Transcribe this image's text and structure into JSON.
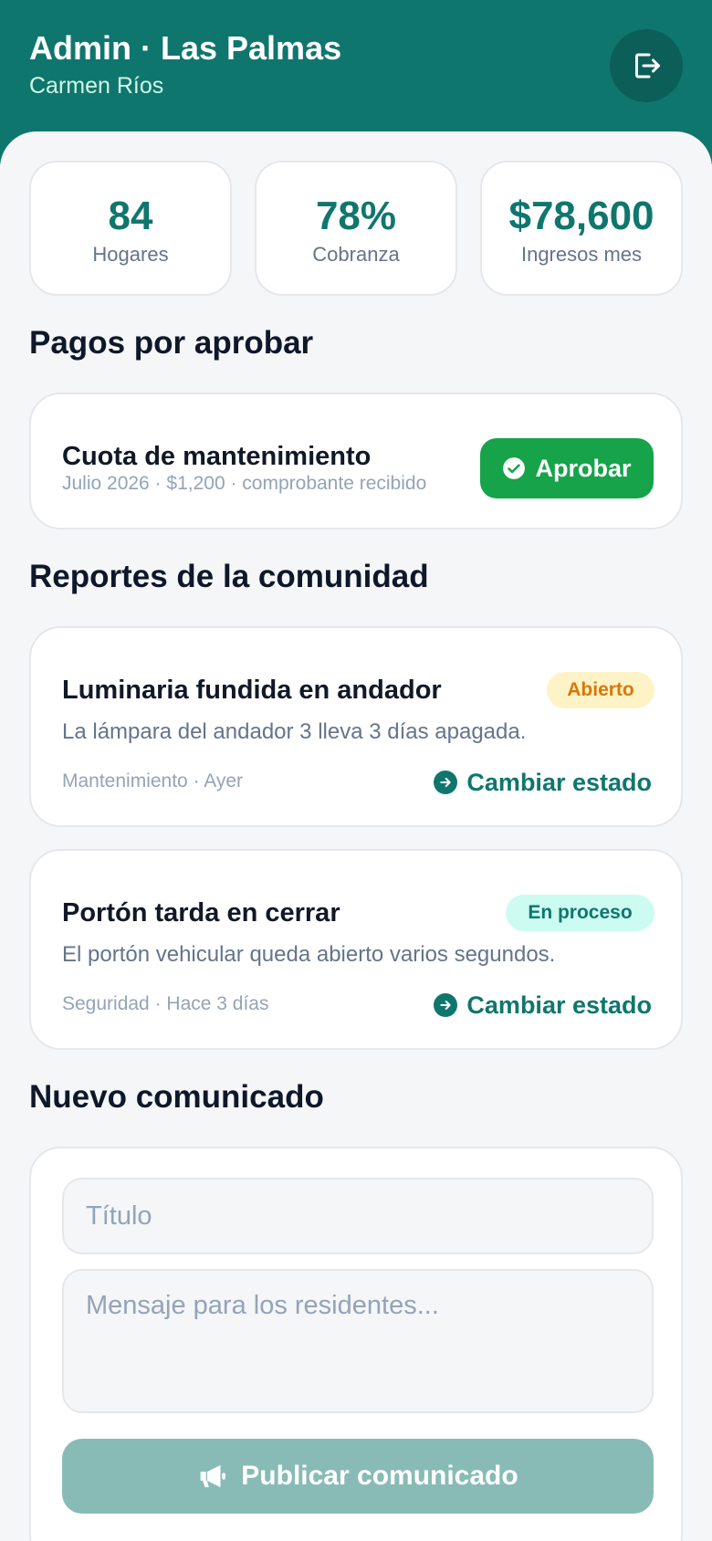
{
  "header": {
    "title": "Admin · Las Palmas",
    "user_name": "Carmen Ríos",
    "logout_icon": "logout-icon"
  },
  "stats": [
    {
      "value": "84",
      "label": "Hogares"
    },
    {
      "value": "78%",
      "label": "Cobranza"
    },
    {
      "value": "$78,600",
      "label": "Ingresos mes"
    }
  ],
  "payments": {
    "section_title": "Pagos por aprobar",
    "items": [
      {
        "title": "Cuota de mantenimiento",
        "detail": "Julio 2026 · $1,200 · comprobante recibido",
        "approve_label": "Aprobar"
      }
    ]
  },
  "reports": {
    "section_title": "Reportes de la comunidad",
    "items": [
      {
        "title": "Luminaria fundida en andador",
        "status": "Abierto",
        "description": "La lámpara del andador 3 lleva 3 días apagada.",
        "meta": "Mantenimiento · Ayer",
        "action_label": "Cambiar estado"
      },
      {
        "title": "Portón tarda en cerrar",
        "status": "En proceso",
        "description": "El portón vehicular queda abierto varios segundos.",
        "meta": "Seguridad · Hace 3 días",
        "action_label": "Cambiar estado"
      }
    ]
  },
  "announcement": {
    "section_title": "Nuevo comunicado",
    "title_value": "",
    "title_placeholder": "Título",
    "message_value": "",
    "message_placeholder": "Mensaje para los residentes...",
    "publish_label": "Publicar comunicado"
  },
  "colors": {
    "primary": "#0f766e",
    "success": "#16a34a",
    "open_badge_bg": "#fef3c7",
    "open_badge_text": "#d97706",
    "progress_badge_bg": "#ccfbf1",
    "progress_badge_text": "#0f766e",
    "disabled_primary": "#88bbb6",
    "background": "#f4f6f8"
  }
}
